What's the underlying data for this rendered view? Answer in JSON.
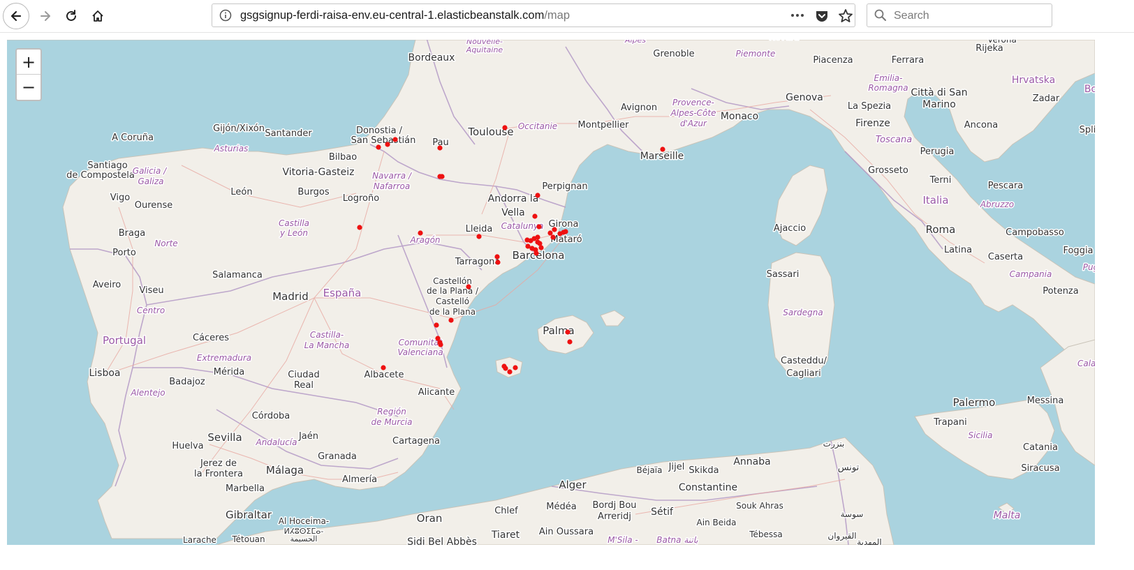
{
  "browser": {
    "url_host": "gsgsignup-ferdi-raisa-env.eu-central-1.elasticbeanstalk.com",
    "url_path": "/map",
    "search_placeholder": "Search",
    "icons": [
      "back-arrow-icon",
      "forward-arrow-icon",
      "reload-icon",
      "home-icon",
      "info-icon",
      "more-dots-icon",
      "pocket-icon",
      "star-icon",
      "search-icon"
    ]
  },
  "map": {
    "zoom_in_label": "+",
    "zoom_out_label": "−",
    "colors": {
      "sea": "#aad3df",
      "land": "#f2efe9",
      "marker": "#ee1111",
      "border": "#b49ac6"
    },
    "cities": [
      "Bordeaux",
      "Grenoble",
      "Novara",
      "Verona",
      "Rijeka",
      "Piacenza",
      "Ferrara",
      "Nouvelle-",
      "Aquitaine",
      "Alpes",
      "Piemonte",
      "Toulouse",
      "Occitanie",
      "Montpellier",
      "Avignon",
      "Provence-",
      "Alpes-Côte",
      "d'Azur",
      "Marseille",
      "Monaco",
      "Genova",
      "La Spezia",
      "Emilia-",
      "Romagna",
      "Città di San",
      "Marino",
      "Hrvatska",
      "Zadar",
      "Split",
      "Bo",
      "Firenze",
      "Toscana",
      "Ancona",
      "Perugia",
      "Grosseto",
      "Terni",
      "Pescara",
      "Italia",
      "Abruzzo",
      "Roma",
      "Campobasso",
      "Foggia",
      "Latina",
      "Caserta",
      "Campania",
      "Potenza",
      "Pug",
      "Calab",
      "Ajaccio",
      "Sassari",
      "Sardegna",
      "Casteddu/",
      "Cagliari",
      "Palermo",
      "Messina",
      "Trapani",
      "Sicilia",
      "Catania",
      "Siracusa",
      "Malta",
      "A Coruña",
      "Gijón/Xixón",
      "Santander",
      "Donostia /",
      "San Sebastián",
      "Pau",
      "Bilbao",
      "Vitoria-Gasteiz",
      "Asturias",
      "Santiago",
      "de Compostela",
      "Galicia /",
      "Galiza",
      "Navarra /",
      "Nafarroa",
      "Vigo",
      "León",
      "Burgos",
      "Logroño",
      "Ourense",
      "Perpignan",
      "Andorra la",
      "Vella",
      "Castilla",
      "y León",
      "Braga",
      "Norte",
      "Aragón",
      "Lleida",
      "Catalunya",
      "Girona",
      "Mataró",
      "Porto",
      "Barcelona",
      "Tarragona",
      "Salamanca",
      "Aveiro",
      "Viseu",
      "Madrid",
      "España",
      "Castellón",
      "de la Plana /",
      "Castelló",
      "de la Plana",
      "Centro",
      "Portugal",
      "Cáceres",
      "Castilla-",
      "La Mancha",
      "Comunitat",
      "Valenciana",
      "Palma",
      "Extremadura",
      "Mérida",
      "Ciudad",
      "Real",
      "Albacete",
      "Lisboa",
      "Badajoz",
      "Alentejo",
      "Alicante",
      "Región",
      "de Murcia",
      "Córdoba",
      "Sevilla",
      "Andalucía",
      "Jaén",
      "Cartagena",
      "Huelva",
      "Granada",
      "Jerez de",
      "la Frontera",
      "Málaga",
      "Almería",
      "Marbella",
      "Gibraltar",
      "Al Hoceima-",
      "ⵍⵃⵓⵙⵉⵎⴰ-",
      "الحسيمة",
      "Larache",
      "Tétouan",
      "Oran",
      "Sidi Bel Abbès",
      "Alger",
      "Médéa",
      "Chlef",
      "Tiaret",
      "Ain Oussara",
      "Béjaïa",
      "Jijel",
      "Skikda",
      "Annaba",
      "Bordj Bou",
      "Arreridj",
      "Sétif",
      "Constantine",
      "Ain Beida",
      "Souk Ahras",
      "Tébessa",
      "M'Sila -",
      "Batna باتنة",
      "بنزرت",
      "تونس",
      "سوسة",
      "القيروان",
      "المهدية"
    ]
  }
}
